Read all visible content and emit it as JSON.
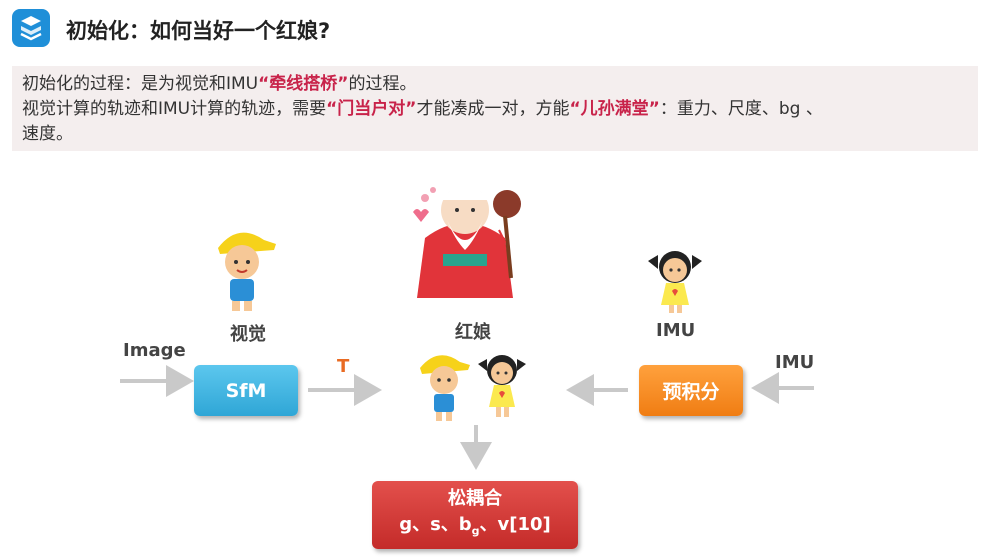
{
  "header": {
    "title": "初始化：如何当好一个红娘?"
  },
  "intro": {
    "line1_prefix": "初始化的过程：是为视觉和IMU",
    "line1_highlight": "“牵线搭桥”",
    "line1_suffix": "的过程。",
    "line2_prefix": "视觉计算的轨迹和IMU计算的轨迹，需要",
    "line2_highlight1": "“门当户对”",
    "line2_middle": "才能凑成一对，方能",
    "line2_highlight2": "“儿孙满堂”",
    "line2_suffix": "：重力、尺度、bg 、",
    "line3": "速度。"
  },
  "diagram": {
    "label_vision": "视觉",
    "label_matchmaker": "红娘",
    "label_imu_top": "IMU",
    "label_image_input": "Image",
    "label_imu_input": "IMU",
    "label_t": "T",
    "box_sfm": "SfM",
    "box_preintegration": "预积分",
    "box_coupling_title": "松耦合",
    "box_coupling_vars_g": "g、s、b",
    "box_coupling_vars_sub": "g",
    "box_coupling_vars_rest": "、v[10]"
  },
  "colors": {
    "highlight": "#c8234a",
    "sfm": "#2fa6d6",
    "preintegration": "#f07d13",
    "coupling": "#c42b29",
    "t_label": "#e96b23"
  }
}
